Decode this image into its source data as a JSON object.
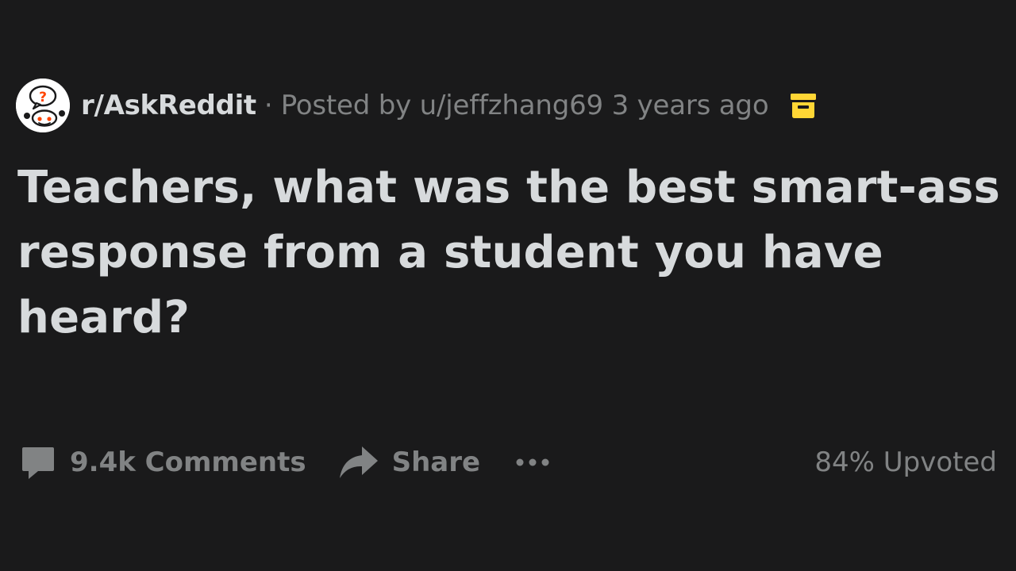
{
  "post": {
    "subreddit": "r/AskReddit",
    "separator": "·",
    "posted_by": "Posted by u/jeffzhang69 3 years ago",
    "title": "Teachers, what was the best smart-ass response from a student you have heard?",
    "icons": {
      "avatar": "subreddit-avatar",
      "archive": "archive-icon",
      "comments": "comment-icon",
      "share": "share-arrow-icon",
      "more": "more-dots-icon"
    },
    "colors": {
      "background": "#1a1a1b",
      "text_primary": "#d7dadc",
      "text_secondary": "#818384",
      "archive": "#ffd635",
      "avatar_accent": "#ff4500"
    }
  },
  "actions": {
    "comments_label": "9.4k Comments",
    "share_label": "Share",
    "upvoted": "84% Upvoted"
  }
}
